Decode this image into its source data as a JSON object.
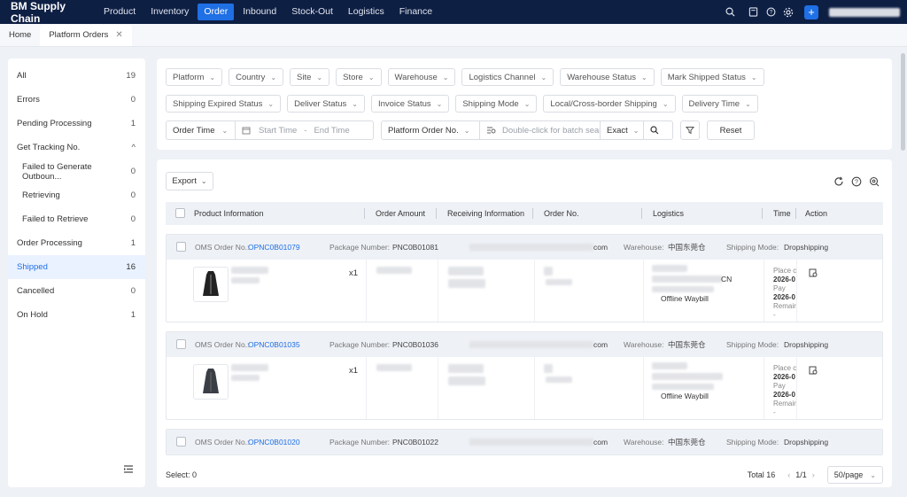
{
  "app": {
    "brand": "BM Supply Chain"
  },
  "topnav": [
    "Product",
    "Inventory",
    "Order",
    "Inbound",
    "Stock-Out",
    "Logistics",
    "Finance"
  ],
  "topnav_active": "Order",
  "tabs": {
    "home": "Home",
    "active": "Platform Orders",
    "close": "✕"
  },
  "sidebar": [
    {
      "label": "All",
      "count": "19"
    },
    {
      "label": "Errors",
      "count": "0"
    },
    {
      "label": "Pending Processing",
      "count": "1"
    },
    {
      "label": "Get Tracking No.",
      "count": "^"
    },
    {
      "label": "Failed to Generate Outboun...",
      "count": "0"
    },
    {
      "label": "Retrieving",
      "count": "0"
    },
    {
      "label": "Failed to Retrieve",
      "count": "0"
    },
    {
      "label": "Order Processing",
      "count": "1"
    },
    {
      "label": "Shipped",
      "count": "16"
    },
    {
      "label": "Cancelled",
      "count": "0"
    },
    {
      "label": "On Hold",
      "count": "1"
    }
  ],
  "filters": {
    "row1": [
      "Platform",
      "Country",
      "Site",
      "Store",
      "Warehouse",
      "Logistics Channel",
      "Warehouse Status",
      "Mark Shipped Status"
    ],
    "row2": [
      "Shipping Expired Status",
      "Deliver Status",
      "Invoice Status",
      "Shipping Mode",
      "Local/Cross-border Shipping",
      "Delivery Time"
    ],
    "order_time": "Order Time",
    "start_time": "Start Time",
    "end_time": "End Time",
    "search_field": "Platform Order No.",
    "search_placeholder": "Double-click for batch search",
    "match": "Exact",
    "reset": "Reset"
  },
  "table": {
    "export": "Export",
    "headers": [
      "Product Information",
      "Order Amount",
      "Receiving Information",
      "Order No.",
      "Logistics",
      "Time",
      "Action"
    ],
    "labels": {
      "oms": "OMS Order No.:",
      "package": "Package Number:",
      "warehouse": "Warehouse:",
      "shipping_mode": "Shipping Mode:",
      "place": "Place c",
      "pay": "Pay",
      "remain": "Remair",
      "dash": "-"
    },
    "orders": [
      {
        "oms": "OPNC0B01079",
        "package": "PNC0B01081",
        "email_tail": "com",
        "warehouse": "中国东莞仓",
        "mode": "Dropshipping",
        "qty": "x1",
        "logistics_tail": "CN",
        "waybill": "Offline Waybill",
        "date1": "2026-0",
        "date2": "2026-0"
      },
      {
        "oms": "OPNC0B01035",
        "package": "PNC0B01036",
        "email_tail": "com",
        "warehouse": "中国东莞仓",
        "mode": "Dropshipping",
        "qty": "x1",
        "logistics_tail": "",
        "waybill": "Offline Waybill",
        "date1": "2026-0",
        "date2": "2026-0"
      },
      {
        "oms": "OPNC0B01020",
        "package": "PNC0B01022",
        "email_tail": "com",
        "warehouse": "中国东莞仓",
        "mode": "Dropshipping"
      }
    ]
  },
  "footer": {
    "select": "Select: 0",
    "total": "Total 16",
    "page": "1/1",
    "page_size": "50/page"
  }
}
